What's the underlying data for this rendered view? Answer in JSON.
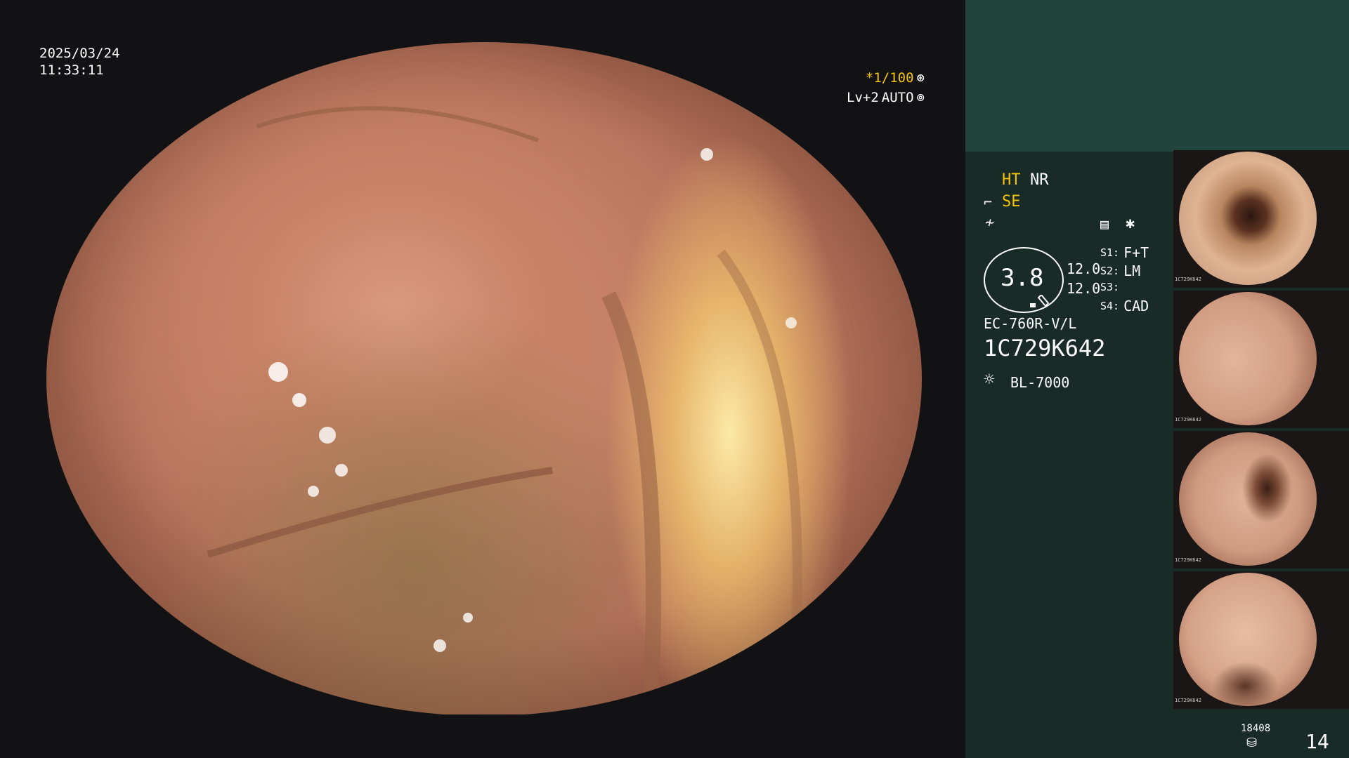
{
  "scope": {
    "date": "2025/03/24",
    "time": "11:33:11",
    "shutter": "*1/100",
    "level": "Lv+2",
    "mode": "AUTO"
  },
  "panel": {
    "ht": "HT",
    "nr": "NR",
    "se": "SE",
    "lens_value": "3.8",
    "value_top": "12.0",
    "value_bottom": "12.0",
    "s1_key": "S1:",
    "s1_value": "F+T",
    "s2_key": "S2:",
    "s2_value": "LM",
    "s3_key": "S3:",
    "s3_value": "",
    "s4_key": "S4:",
    "s4_value": "CAD",
    "model": "EC-760R-V/L",
    "serial": "1C729K642",
    "light_source": "BL-7000"
  },
  "thumbnails": [
    {
      "caption": "1C729K642"
    },
    {
      "caption": "1C729K642"
    },
    {
      "caption": "1C729K642"
    },
    {
      "caption": "1C729K642"
    }
  ],
  "footer": {
    "image_count": "18408",
    "page": "14"
  },
  "colors": {
    "accent_yellow": "#f5c400",
    "panel_bg": "#192b26",
    "panel_top": "#21453c"
  },
  "icons": [
    "wrench-icon",
    "wave-icon",
    "settings-icon",
    "asterisk-icon",
    "light-source-icon",
    "database-icon",
    "circle-icon"
  ]
}
